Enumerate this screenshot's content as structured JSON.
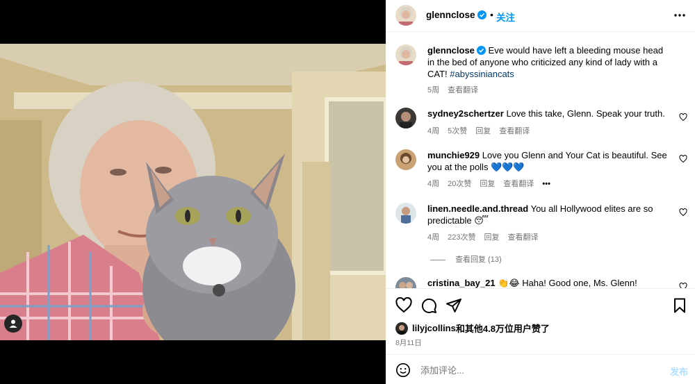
{
  "post": {
    "author": "glennclose",
    "follow_label": "关注",
    "dot": "•",
    "caption_text": "Eve would have left a bleeding mouse head in the bed of anyone who criticized any kind of lady with a CAT!",
    "caption_hashtag": "#abyssiniancats",
    "caption_age": "5周",
    "translate_label": "查看翻译",
    "liked_by_user": "lilyjcollins",
    "likes_text": "和其他4.8万位用户赞了",
    "date": "8月11日"
  },
  "comments": [
    {
      "user": "sydney2schertzer",
      "text": "Love this take, Glenn. Speak your truth.",
      "age": "4周",
      "likes": "5次赞",
      "reply": "回复",
      "translate": "查看翻译"
    },
    {
      "user": "munchie929",
      "text": "Love you Glenn and Your Cat is beautiful. See you at the polls 💙💙💙",
      "age": "4周",
      "likes": "20次赞",
      "reply": "回复",
      "translate": "查看翻译"
    },
    {
      "user": "linen.needle.and.thread",
      "text": "You all Hollywood elites are so predictable 😴",
      "age": "4周",
      "likes": "223次赞",
      "reply": "回复",
      "translate": "查看翻译"
    },
    {
      "user": "cristina_bay_21",
      "text": "👏😂 Haha! Good one, Ms. Glenn!"
    }
  ],
  "view_replies": "查看回复 (13)",
  "compose": {
    "placeholder": "添加评论...",
    "post_label": "发布"
  },
  "icons": {
    "more": "more-horizontal-icon",
    "verified": "verified-badge-icon",
    "like": "heart-icon",
    "comment": "comment-icon",
    "share": "share-icon",
    "save": "bookmark-icon",
    "emoji": "emoji-icon",
    "user_tag": "user-tag-icon"
  },
  "colors": {
    "accent": "#0095f6",
    "muted": "#737373",
    "post_disabled": "#b2dffc",
    "hashtag": "#00376b"
  }
}
